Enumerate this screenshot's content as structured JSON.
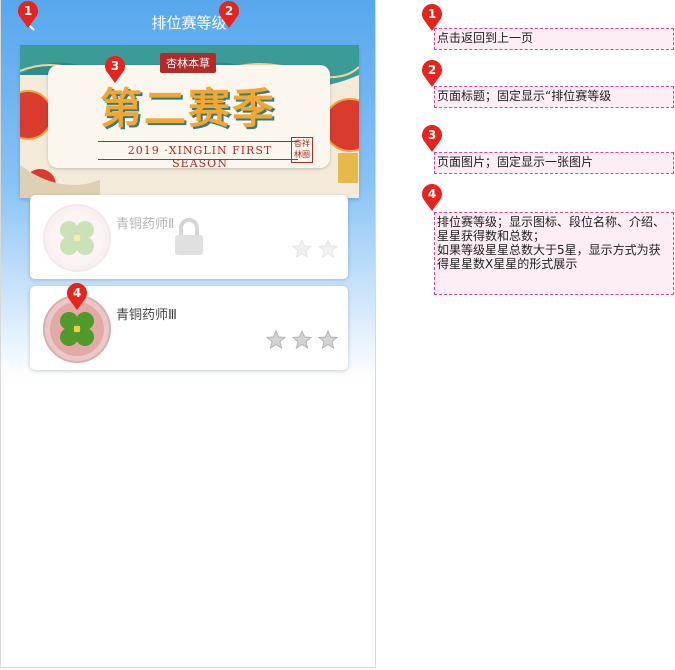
{
  "header": {
    "title": "排位赛等级"
  },
  "banner": {
    "brand": "杏林本草",
    "season": "第二赛季",
    "subtitle": "2019 ·XINGLIN FIRST SEASON",
    "seal": "杏祥\n林圈"
  },
  "ranks": [
    {
      "name": "青铜药师Ⅱ",
      "locked": true,
      "stars_earned": 0,
      "stars_total": 2
    },
    {
      "name": "青铜药师Ⅲ",
      "locked": false,
      "stars_earned": 0,
      "stars_total": 3
    }
  ],
  "annotations": [
    {
      "num": "1",
      "text": "点击返回到上一页"
    },
    {
      "num": "2",
      "text": "页面标题；固定显示“排位赛等级"
    },
    {
      "num": "3",
      "text": "页面图片；固定显示一张图片"
    },
    {
      "num": "4",
      "text": "排位赛等级；显示图标、段位名称、介绍、星星获得数和总数；\n如果等级星星总数大于5星，显示方式为获得星星数X星星的形式展示"
    }
  ],
  "colors": {
    "header_blue": "#57a7ee",
    "marker_red": "#e8221c",
    "note_border": "#e8418f",
    "brand_red": "#b42a26",
    "season_orange": "#f5a531"
  }
}
